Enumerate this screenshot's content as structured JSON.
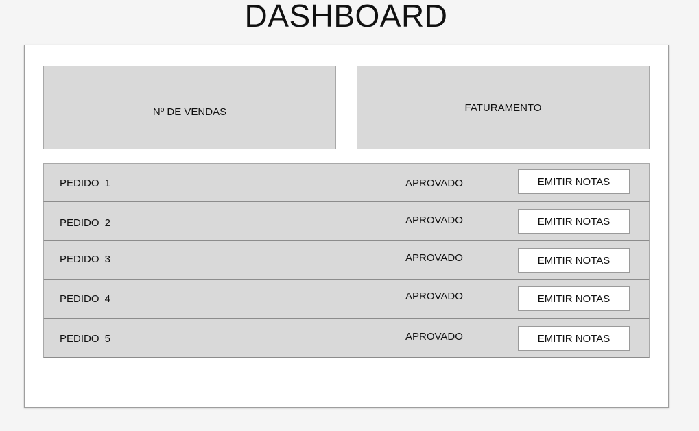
{
  "page": {
    "title": "DASHBOARD"
  },
  "stats": {
    "sales_label": "Nº DE VENDAS",
    "revenue_label": "FATURAMENTO"
  },
  "orders": [
    {
      "name": "PEDIDO  1",
      "status": "APROVADO",
      "action": "EMITIR NOTAS"
    },
    {
      "name": "PEDIDO  2",
      "status": "APROVADO",
      "action": "EMITIR NOTAS"
    },
    {
      "name": "PEDIDO  3",
      "status": "APROVADO",
      "action": "EMITIR NOTAS"
    },
    {
      "name": "PEDIDO  4",
      "status": "APROVADO",
      "action": "EMITIR NOTAS"
    },
    {
      "name": "PEDIDO  5",
      "status": "APROVADO",
      "action": "EMITIR NOTAS"
    }
  ],
  "colors": {
    "background": "#f5f5f5",
    "panel": "#ffffff",
    "card": "#d9d9d9",
    "border": "#a8a8a8",
    "text": "#111111"
  }
}
